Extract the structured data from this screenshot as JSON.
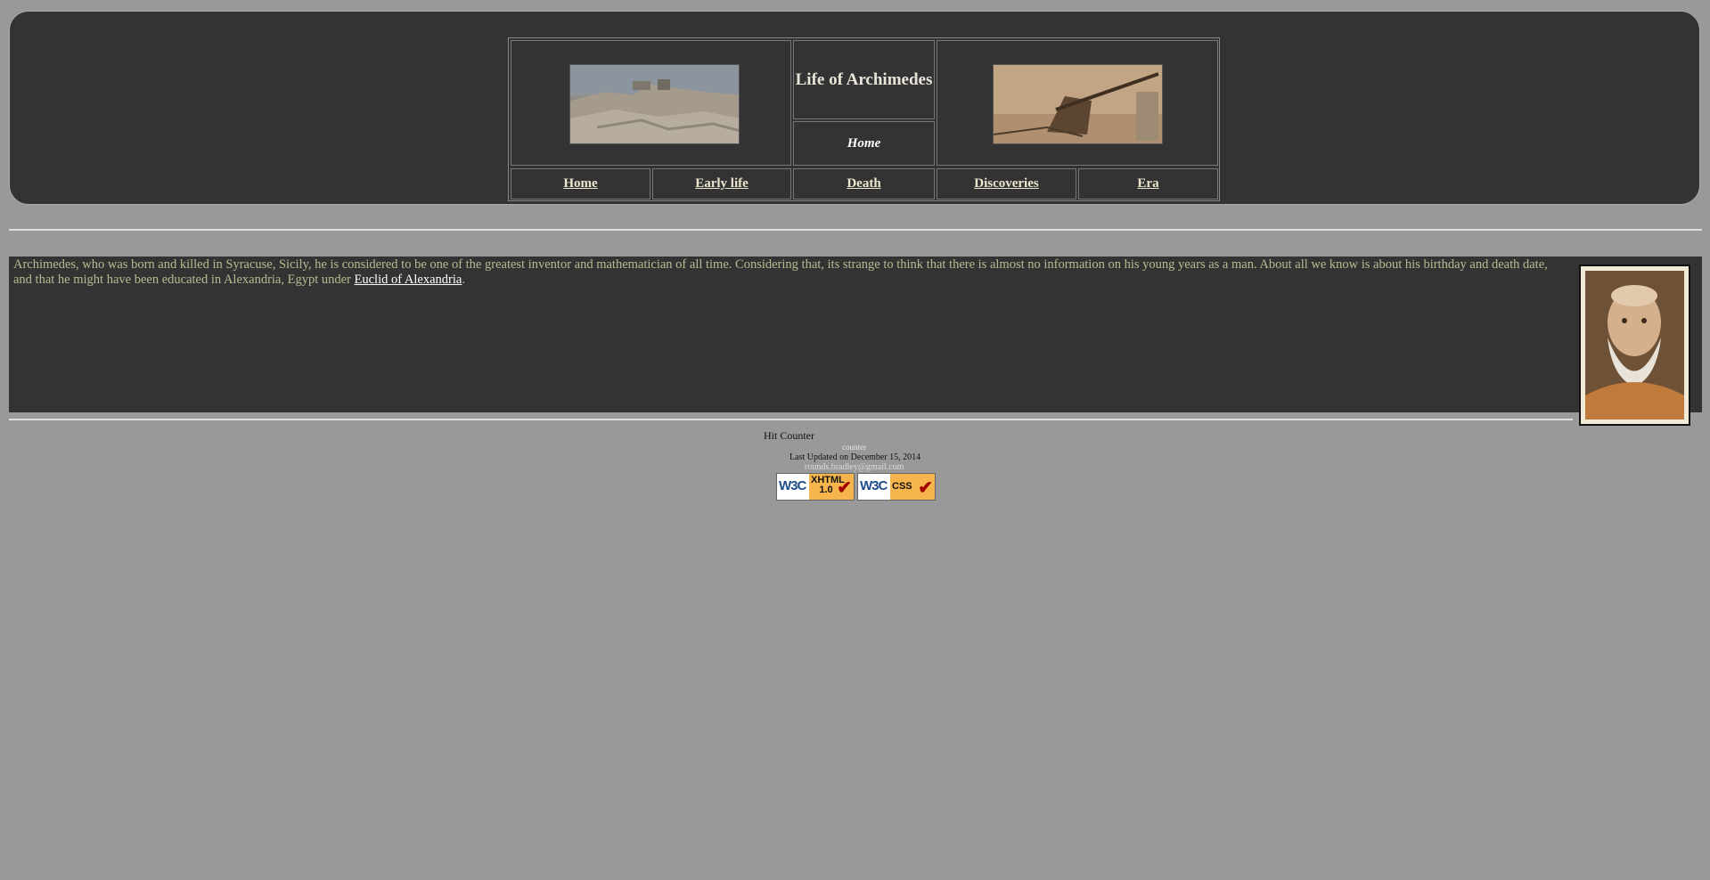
{
  "header": {
    "title": "Life of Archimedes",
    "current_page": "Home",
    "nav": [
      {
        "label": "Home"
      },
      {
        "label": "Early life"
      },
      {
        "label": "Death"
      },
      {
        "label": "Discoveries"
      },
      {
        "label": "Era"
      }
    ]
  },
  "content": {
    "intro_text": "Archimedes, who was born and killed in Syracuse, Sicily, he is considered to be one of the greatest inventor and mathematician of all time. Considering that, its strange to think that there is almost no information on his young years as a man. About all we know is about his birthday and death date, and that he might have been educated in Alexandria, Egypt under ",
    "link_text": "Euclid of Alexandria",
    "intro_end": "."
  },
  "footer": {
    "hit_counter": "Hit Counter",
    "counter_alt": "counter",
    "last_updated": "Last Updated on December 15, 2014",
    "email": "rounds.bradley@gmail.com",
    "badges": [
      {
        "logo": "W3C",
        "label": "XHTML 1.0"
      },
      {
        "logo": "W3C",
        "label": "CSS"
      }
    ]
  },
  "colors": {
    "page_bg": "#999999",
    "panel_bg": "#333333",
    "text": "#b4bd92",
    "nav_link": "#ece6cf"
  }
}
